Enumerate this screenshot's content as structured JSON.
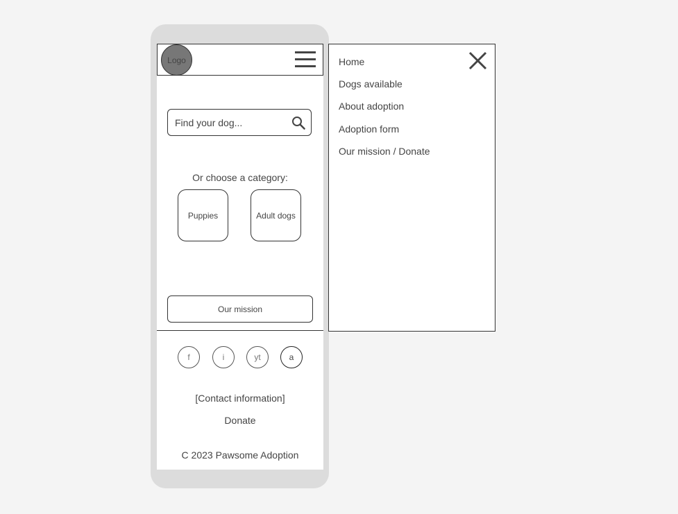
{
  "header": {
    "logo_label": "Logo"
  },
  "search": {
    "placeholder": "Find your dog..."
  },
  "categories": {
    "heading": "Or choose a category:",
    "items": [
      {
        "label": "Puppies"
      },
      {
        "label": "Adult dogs"
      }
    ]
  },
  "mission_button": {
    "label": "Our mission"
  },
  "social": {
    "items": [
      {
        "label": "f"
      },
      {
        "label": "i"
      },
      {
        "label": "yt"
      },
      {
        "label": "a"
      }
    ]
  },
  "footer": {
    "contact": "[Contact information]",
    "donate": "Donate",
    "copyright": "C 2023 Pawsome Adoption"
  },
  "menu": {
    "items": [
      {
        "label": "Home"
      },
      {
        "label": "Dogs available"
      },
      {
        "label": "About adoption"
      },
      {
        "label": "Adoption form"
      },
      {
        "label": "Our mission / Donate"
      }
    ]
  },
  "icons": {
    "hamburger": "hamburger-icon",
    "search": "search-icon",
    "close": "close-icon"
  }
}
